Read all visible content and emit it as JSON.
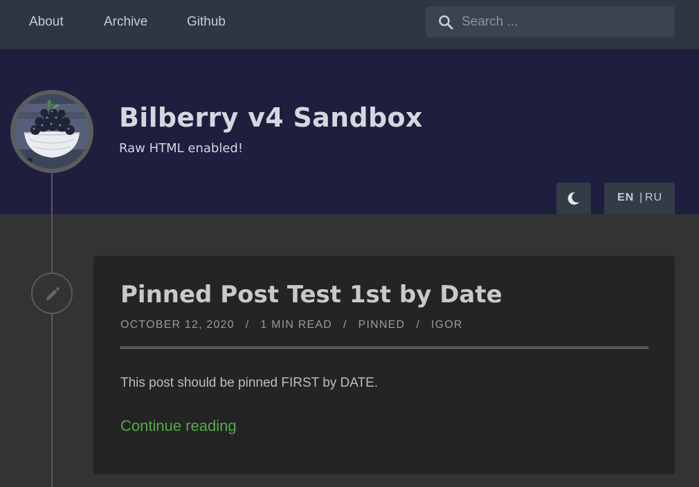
{
  "nav": {
    "links": [
      "About",
      "Archive",
      "Github"
    ],
    "search_placeholder": "Search ..."
  },
  "header": {
    "title": "Bilberry v4 Sandbox",
    "subtitle": "Raw HTML enabled!",
    "language": {
      "active": "EN",
      "separator": "|",
      "other": "RU"
    }
  },
  "post": {
    "title": "Pinned Post Test 1st by Date",
    "date": "OCTOBER 12, 2020",
    "read_time": "1 MIN READ",
    "tag": "PINNED",
    "author": "IGOR",
    "meta_separator": "/",
    "excerpt": "This post should be pinned FIRST by DATE.",
    "continue_label": "Continue reading"
  },
  "colors": {
    "nav_bg": "#2d3642",
    "header_bg": "#1e1e3f",
    "page_bg": "#333333",
    "card_bg": "#242424",
    "link_green": "#55a84a"
  },
  "icons": {
    "search": "search-icon",
    "theme": "moon-icon",
    "post_type": "pencil-icon"
  }
}
